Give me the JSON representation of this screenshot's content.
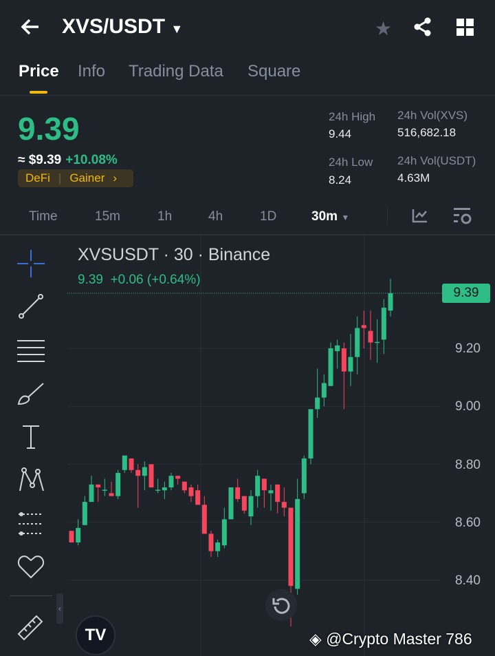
{
  "header": {
    "title": "XVS/USDT"
  },
  "tabs": [
    {
      "label": "Price"
    },
    {
      "label": "Info"
    },
    {
      "label": "Trading Data"
    },
    {
      "label": "Square"
    }
  ],
  "price": {
    "last": "9.39",
    "usd": "≈ $9.39",
    "change": "+10.08%",
    "tags": [
      "DeFi",
      "Gainer"
    ]
  },
  "stats": {
    "high_label": "24h High",
    "high": "9.44",
    "low_label": "24h Low",
    "low": "8.24",
    "vol_base_label": "24h Vol(XVS)",
    "vol_base": "516,682.18",
    "vol_quote_label": "24h Vol(USDT)",
    "vol_quote": "4.63M"
  },
  "intervals": [
    "Time",
    "15m",
    "1h",
    "4h",
    "1D",
    "30m"
  ],
  "chart": {
    "title": "XVSUSDT · 30 · Binance",
    "ohlc_line": "9.39  +0.06 (+0.64%)",
    "last_label": "9.39"
  },
  "watermark": "@Crypto Master 786",
  "colors": {
    "up": "#2ebd85",
    "down": "#f6465d",
    "accent": "#f0b90b"
  },
  "chart_data": {
    "type": "candlestick",
    "title": "XVSUSDT · 30 · Binance",
    "yticks": [
      "9.20",
      "9.00",
      "8.80",
      "8.60",
      "8.40"
    ],
    "ylim": [
      8.22,
      9.47
    ],
    "candles": [
      [
        8.57,
        8.53,
        8.57,
        8.53
      ],
      [
        8.53,
        8.58,
        8.61,
        8.52
      ],
      [
        8.59,
        8.67,
        8.69,
        8.59
      ],
      [
        8.67,
        8.73,
        8.76,
        8.67
      ],
      [
        8.73,
        8.72,
        8.73,
        8.67
      ],
      [
        8.71,
        8.712,
        8.75,
        8.69
      ],
      [
        8.7,
        8.69,
        8.74,
        8.69
      ],
      [
        8.69,
        8.77,
        8.78,
        8.68
      ],
      [
        8.78,
        8.83,
        8.83,
        8.77
      ],
      [
        8.82,
        8.78,
        8.82,
        8.77
      ],
      [
        8.78,
        8.76,
        8.8,
        8.65
      ],
      [
        8.76,
        8.79,
        8.81,
        8.71
      ],
      [
        8.8,
        8.72,
        8.8,
        8.72
      ],
      [
        8.71,
        8.712,
        8.75,
        8.7
      ],
      [
        8.71,
        8.72,
        8.74,
        8.68
      ],
      [
        8.72,
        8.76,
        8.77,
        8.71
      ],
      [
        8.76,
        8.75,
        8.76,
        8.73
      ],
      [
        8.74,
        8.71,
        8.74,
        8.7
      ],
      [
        8.72,
        8.69,
        8.73,
        8.67
      ],
      [
        8.71,
        8.66,
        8.73,
        8.66
      ],
      [
        8.66,
        8.56,
        8.69,
        8.56
      ],
      [
        8.56,
        8.5,
        8.57,
        8.48
      ],
      [
        8.5,
        8.53,
        8.54,
        8.48
      ],
      [
        8.52,
        8.61,
        8.65,
        8.51
      ],
      [
        8.61,
        8.72,
        8.72,
        8.61
      ],
      [
        8.72,
        8.68,
        8.75,
        8.67
      ],
      [
        8.69,
        8.64,
        8.69,
        8.63
      ],
      [
        8.62,
        8.69,
        8.71,
        8.59
      ],
      [
        8.69,
        8.76,
        8.78,
        8.65
      ],
      [
        8.75,
        8.71,
        8.75,
        8.65
      ],
      [
        8.7,
        8.71,
        8.73,
        8.64
      ],
      [
        8.73,
        8.67,
        8.73,
        8.63
      ],
      [
        8.67,
        8.65,
        8.72,
        8.62
      ],
      [
        8.65,
        8.38,
        8.65,
        8.24
      ],
      [
        8.37,
        8.68,
        8.75,
        8.35
      ],
      [
        8.7,
        8.82,
        8.83,
        8.68
      ],
      [
        8.82,
        8.99,
        8.99,
        8.8
      ],
      [
        8.99,
        9.03,
        9.13,
        8.96
      ],
      [
        9.03,
        9.08,
        9.11,
        9.0
      ],
      [
        9.07,
        9.2,
        9.22,
        9.07
      ],
      [
        9.19,
        9.21,
        9.23,
        9.13
      ],
      [
        9.2,
        9.12,
        9.22,
        8.99
      ],
      [
        9.12,
        9.17,
        9.25,
        9.07
      ],
      [
        9.17,
        9.27,
        9.31,
        9.11
      ],
      [
        9.28,
        9.27,
        9.33,
        9.2
      ],
      [
        9.26,
        9.22,
        9.33,
        9.16
      ],
      [
        9.22,
        9.222,
        9.3,
        9.15
      ],
      [
        9.23,
        9.34,
        9.37,
        9.18
      ],
      [
        9.33,
        9.39,
        9.44,
        9.31
      ]
    ],
    "candle_format": [
      "open",
      "close",
      "high",
      "low"
    ]
  }
}
